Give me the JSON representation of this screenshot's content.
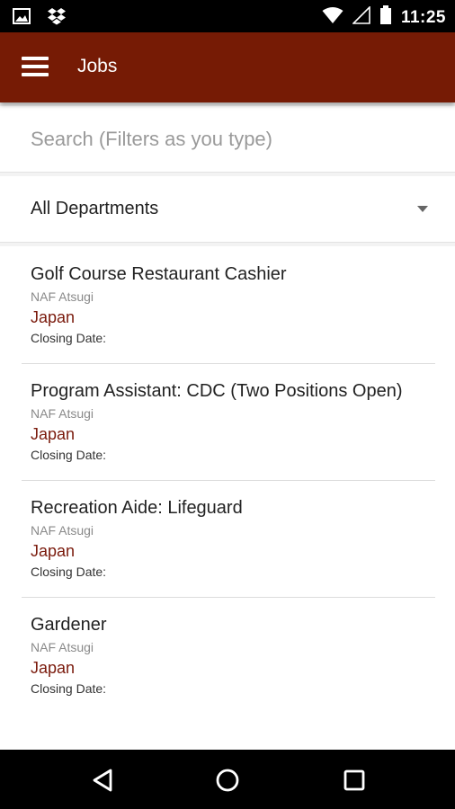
{
  "status_bar": {
    "time": "11:25",
    "icons": [
      "image-icon",
      "dropbox-icon",
      "wifi-icon",
      "signal-icon",
      "battery-icon"
    ]
  },
  "app_bar": {
    "title": "Jobs",
    "color": "#761b05"
  },
  "search": {
    "placeholder": "Search (Filters as you type)",
    "value": ""
  },
  "department_filter": {
    "selected": "All Departments"
  },
  "jobs": [
    {
      "title": "Golf Course Restaurant Cashier",
      "base": "NAF Atsugi",
      "country": "Japan",
      "closing": "Closing Date:"
    },
    {
      "title": "Program Assistant: CDC (Two Positions Open)",
      "base": "NAF Atsugi",
      "country": "Japan",
      "closing": "Closing Date:"
    },
    {
      "title": "Recreation Aide: Lifeguard",
      "base": "NAF Atsugi",
      "country": "Japan",
      "closing": "Closing Date:"
    },
    {
      "title": "Gardener",
      "base": "NAF Atsugi",
      "country": "Japan",
      "closing": "Closing Date:"
    }
  ],
  "nav_bar": {
    "icons": [
      "back-icon",
      "home-icon",
      "recents-icon"
    ]
  }
}
